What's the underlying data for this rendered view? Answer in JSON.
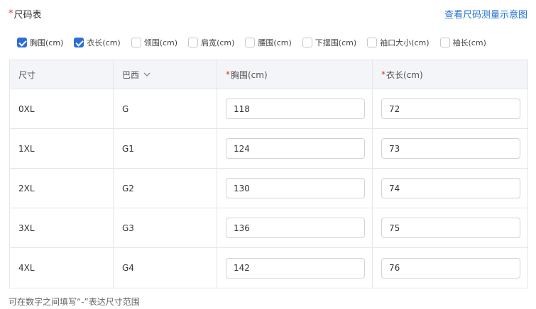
{
  "header": {
    "title_mark": "*",
    "title": "尺码表",
    "guide_link": "查看尺码测量示意图"
  },
  "measure_options": [
    {
      "label": "胸围(cm)",
      "checked": true
    },
    {
      "label": "衣长(cm)",
      "checked": true
    },
    {
      "label": "领围(cm)",
      "checked": false
    },
    {
      "label": "肩宽(cm)",
      "checked": false
    },
    {
      "label": "腰围(cm)",
      "checked": false
    },
    {
      "label": "下摆围(cm)",
      "checked": false
    },
    {
      "label": "袖口大小(cm)",
      "checked": false
    },
    {
      "label": "袖长(cm)",
      "checked": false
    }
  ],
  "table": {
    "headers": {
      "size": "尺寸",
      "standard": "巴西",
      "chest_mark": "*",
      "chest": "胸围(cm)",
      "length_mark": "*",
      "length": "衣长(cm)"
    },
    "rows": [
      {
        "size": "0XL",
        "standard": "G",
        "chest": "118",
        "length": "72"
      },
      {
        "size": "1XL",
        "standard": "G1",
        "chest": "124",
        "length": "73"
      },
      {
        "size": "2XL",
        "standard": "G2",
        "chest": "130",
        "length": "74"
      },
      {
        "size": "3XL",
        "standard": "G3",
        "chest": "136",
        "length": "75"
      },
      {
        "size": "4XL",
        "standard": "G4",
        "chest": "142",
        "length": "76"
      }
    ]
  },
  "hint": "可在数字之间填写“-”表达尺寸范围",
  "colors": {
    "accent": "#2b6fd6",
    "link": "#1f6fd6",
    "required": "#e0302b"
  }
}
